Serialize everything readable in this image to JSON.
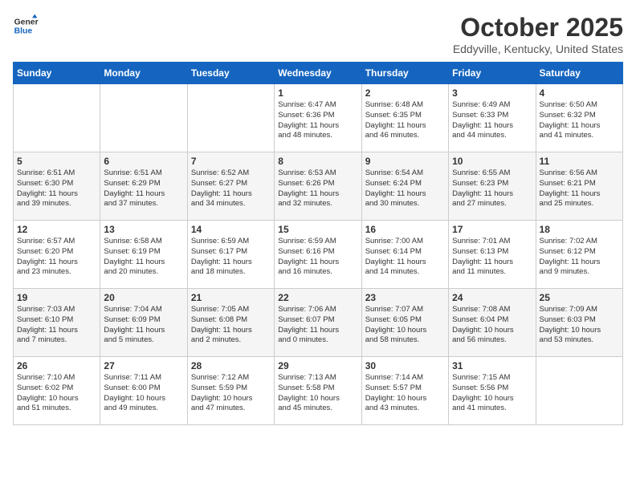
{
  "header": {
    "logo_line1": "General",
    "logo_line2": "Blue",
    "month": "October 2025",
    "location": "Eddyville, Kentucky, United States"
  },
  "weekdays": [
    "Sunday",
    "Monday",
    "Tuesday",
    "Wednesday",
    "Thursday",
    "Friday",
    "Saturday"
  ],
  "weeks": [
    [
      {
        "day": "",
        "info": ""
      },
      {
        "day": "",
        "info": ""
      },
      {
        "day": "",
        "info": ""
      },
      {
        "day": "1",
        "info": "Sunrise: 6:47 AM\nSunset: 6:36 PM\nDaylight: 11 hours\nand 48 minutes."
      },
      {
        "day": "2",
        "info": "Sunrise: 6:48 AM\nSunset: 6:35 PM\nDaylight: 11 hours\nand 46 minutes."
      },
      {
        "day": "3",
        "info": "Sunrise: 6:49 AM\nSunset: 6:33 PM\nDaylight: 11 hours\nand 44 minutes."
      },
      {
        "day": "4",
        "info": "Sunrise: 6:50 AM\nSunset: 6:32 PM\nDaylight: 11 hours\nand 41 minutes."
      }
    ],
    [
      {
        "day": "5",
        "info": "Sunrise: 6:51 AM\nSunset: 6:30 PM\nDaylight: 11 hours\nand 39 minutes."
      },
      {
        "day": "6",
        "info": "Sunrise: 6:51 AM\nSunset: 6:29 PM\nDaylight: 11 hours\nand 37 minutes."
      },
      {
        "day": "7",
        "info": "Sunrise: 6:52 AM\nSunset: 6:27 PM\nDaylight: 11 hours\nand 34 minutes."
      },
      {
        "day": "8",
        "info": "Sunrise: 6:53 AM\nSunset: 6:26 PM\nDaylight: 11 hours\nand 32 minutes."
      },
      {
        "day": "9",
        "info": "Sunrise: 6:54 AM\nSunset: 6:24 PM\nDaylight: 11 hours\nand 30 minutes."
      },
      {
        "day": "10",
        "info": "Sunrise: 6:55 AM\nSunset: 6:23 PM\nDaylight: 11 hours\nand 27 minutes."
      },
      {
        "day": "11",
        "info": "Sunrise: 6:56 AM\nSunset: 6:21 PM\nDaylight: 11 hours\nand 25 minutes."
      }
    ],
    [
      {
        "day": "12",
        "info": "Sunrise: 6:57 AM\nSunset: 6:20 PM\nDaylight: 11 hours\nand 23 minutes."
      },
      {
        "day": "13",
        "info": "Sunrise: 6:58 AM\nSunset: 6:19 PM\nDaylight: 11 hours\nand 20 minutes."
      },
      {
        "day": "14",
        "info": "Sunrise: 6:59 AM\nSunset: 6:17 PM\nDaylight: 11 hours\nand 18 minutes."
      },
      {
        "day": "15",
        "info": "Sunrise: 6:59 AM\nSunset: 6:16 PM\nDaylight: 11 hours\nand 16 minutes."
      },
      {
        "day": "16",
        "info": "Sunrise: 7:00 AM\nSunset: 6:14 PM\nDaylight: 11 hours\nand 14 minutes."
      },
      {
        "day": "17",
        "info": "Sunrise: 7:01 AM\nSunset: 6:13 PM\nDaylight: 11 hours\nand 11 minutes."
      },
      {
        "day": "18",
        "info": "Sunrise: 7:02 AM\nSunset: 6:12 PM\nDaylight: 11 hours\nand 9 minutes."
      }
    ],
    [
      {
        "day": "19",
        "info": "Sunrise: 7:03 AM\nSunset: 6:10 PM\nDaylight: 11 hours\nand 7 minutes."
      },
      {
        "day": "20",
        "info": "Sunrise: 7:04 AM\nSunset: 6:09 PM\nDaylight: 11 hours\nand 5 minutes."
      },
      {
        "day": "21",
        "info": "Sunrise: 7:05 AM\nSunset: 6:08 PM\nDaylight: 11 hours\nand 2 minutes."
      },
      {
        "day": "22",
        "info": "Sunrise: 7:06 AM\nSunset: 6:07 PM\nDaylight: 11 hours\nand 0 minutes."
      },
      {
        "day": "23",
        "info": "Sunrise: 7:07 AM\nSunset: 6:05 PM\nDaylight: 10 hours\nand 58 minutes."
      },
      {
        "day": "24",
        "info": "Sunrise: 7:08 AM\nSunset: 6:04 PM\nDaylight: 10 hours\nand 56 minutes."
      },
      {
        "day": "25",
        "info": "Sunrise: 7:09 AM\nSunset: 6:03 PM\nDaylight: 10 hours\nand 53 minutes."
      }
    ],
    [
      {
        "day": "26",
        "info": "Sunrise: 7:10 AM\nSunset: 6:02 PM\nDaylight: 10 hours\nand 51 minutes."
      },
      {
        "day": "27",
        "info": "Sunrise: 7:11 AM\nSunset: 6:00 PM\nDaylight: 10 hours\nand 49 minutes."
      },
      {
        "day": "28",
        "info": "Sunrise: 7:12 AM\nSunset: 5:59 PM\nDaylight: 10 hours\nand 47 minutes."
      },
      {
        "day": "29",
        "info": "Sunrise: 7:13 AM\nSunset: 5:58 PM\nDaylight: 10 hours\nand 45 minutes."
      },
      {
        "day": "30",
        "info": "Sunrise: 7:14 AM\nSunset: 5:57 PM\nDaylight: 10 hours\nand 43 minutes."
      },
      {
        "day": "31",
        "info": "Sunrise: 7:15 AM\nSunset: 5:56 PM\nDaylight: 10 hours\nand 41 minutes."
      },
      {
        "day": "",
        "info": ""
      }
    ]
  ]
}
